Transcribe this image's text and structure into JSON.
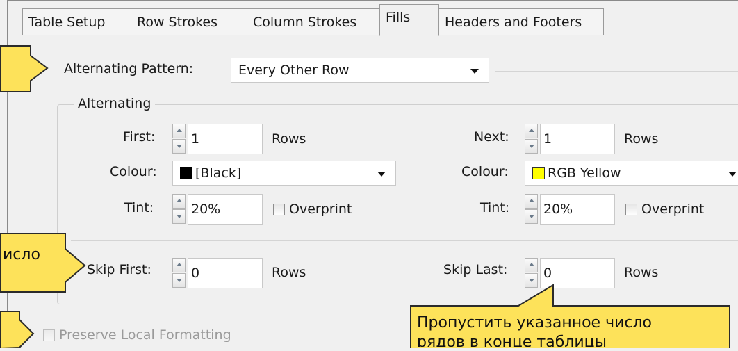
{
  "tabs": [
    {
      "label": "Table Setup"
    },
    {
      "label": "Row Strokes"
    },
    {
      "label": "Column Strokes"
    },
    {
      "label": "Fills"
    },
    {
      "label": "Headers and Footers"
    }
  ],
  "alternating_pattern": {
    "label_u": "A",
    "label_rest": "lternating Pattern:",
    "value": "Every Other Row"
  },
  "alternating_group": {
    "title": "Alternating",
    "left": {
      "first_label_a": "Fir",
      "first_label_u": "s",
      "first_label_b": "t:",
      "first_value": "1",
      "rows_label": "Rows",
      "colour_label_u": "C",
      "colour_label_rest": "olour:",
      "colour_value": "[Black]",
      "colour_swatch": "#000000",
      "tint_label_u": "T",
      "tint_label_rest": "int:",
      "tint_value": "20%",
      "overprint_label": "Overprint"
    },
    "right": {
      "next_label_a": "Ne",
      "next_label_u": "x",
      "next_label_b": "t:",
      "next_value": "1",
      "rows_label": "Rows",
      "colour_label_a": "Co",
      "colour_label_u": "l",
      "colour_label_b": "our:",
      "colour_value": "RGB Yellow",
      "colour_swatch": "#ffff00",
      "tint_label": "Tint:",
      "tint_value": "20%",
      "overprint_label": "Overprint"
    }
  },
  "skip": {
    "first_label_a": "Skip ",
    "first_label_u": "F",
    "first_label_b": "irst:",
    "first_value": "0",
    "first_rows": "Rows",
    "last_label_a": "S",
    "last_label_u": "k",
    "last_label_b": "ip Last:",
    "last_value": "0",
    "last_rows": "Rows"
  },
  "preserve_local_formatting": "Preserve Local Formatting",
  "callouts": {
    "skip_first_partial": "исло",
    "skip_last_line1": "Пропустить указанное число",
    "skip_last_line2": "рядов в конце таблицы"
  },
  "colors": {
    "callout_fill": "#fde25a",
    "callout_stroke": "#2b2b2b"
  }
}
